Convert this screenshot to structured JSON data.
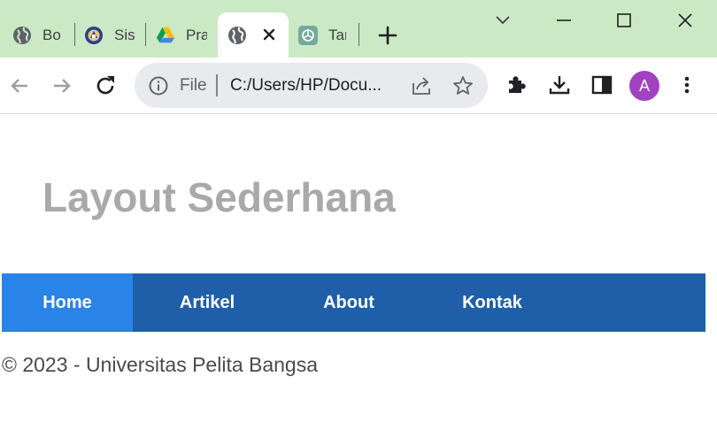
{
  "browser": {
    "tabs": [
      {
        "title": "Bo",
        "icon": "globe-icon",
        "active": false
      },
      {
        "title": "Sis",
        "icon": "university-logo-icon",
        "active": false
      },
      {
        "title": "Pra",
        "icon": "google-drive-icon",
        "active": false
      },
      {
        "title": "",
        "icon": "globe-icon",
        "active": true
      },
      {
        "title": "Tar",
        "icon": "chatgpt-icon",
        "active": false
      }
    ],
    "omnibox": {
      "scheme_label": "File",
      "url": "C:/Users/HP/Docu..."
    },
    "profile_initial": "A",
    "colors": {
      "tabstrip": "#cbe9c4",
      "avatar": "#a142c2"
    }
  },
  "page": {
    "title": "Layout Sederhana",
    "nav": [
      {
        "label": "Home",
        "active": true
      },
      {
        "label": "Artikel",
        "active": false
      },
      {
        "label": "About",
        "active": false
      },
      {
        "label": "Kontak",
        "active": false
      }
    ],
    "footer": "© 2023 - Universitas Pelita Bangsa",
    "colors": {
      "title": "#a9a9a9",
      "navbar": "#1f5faa",
      "nav_active": "#2a83e6"
    }
  }
}
